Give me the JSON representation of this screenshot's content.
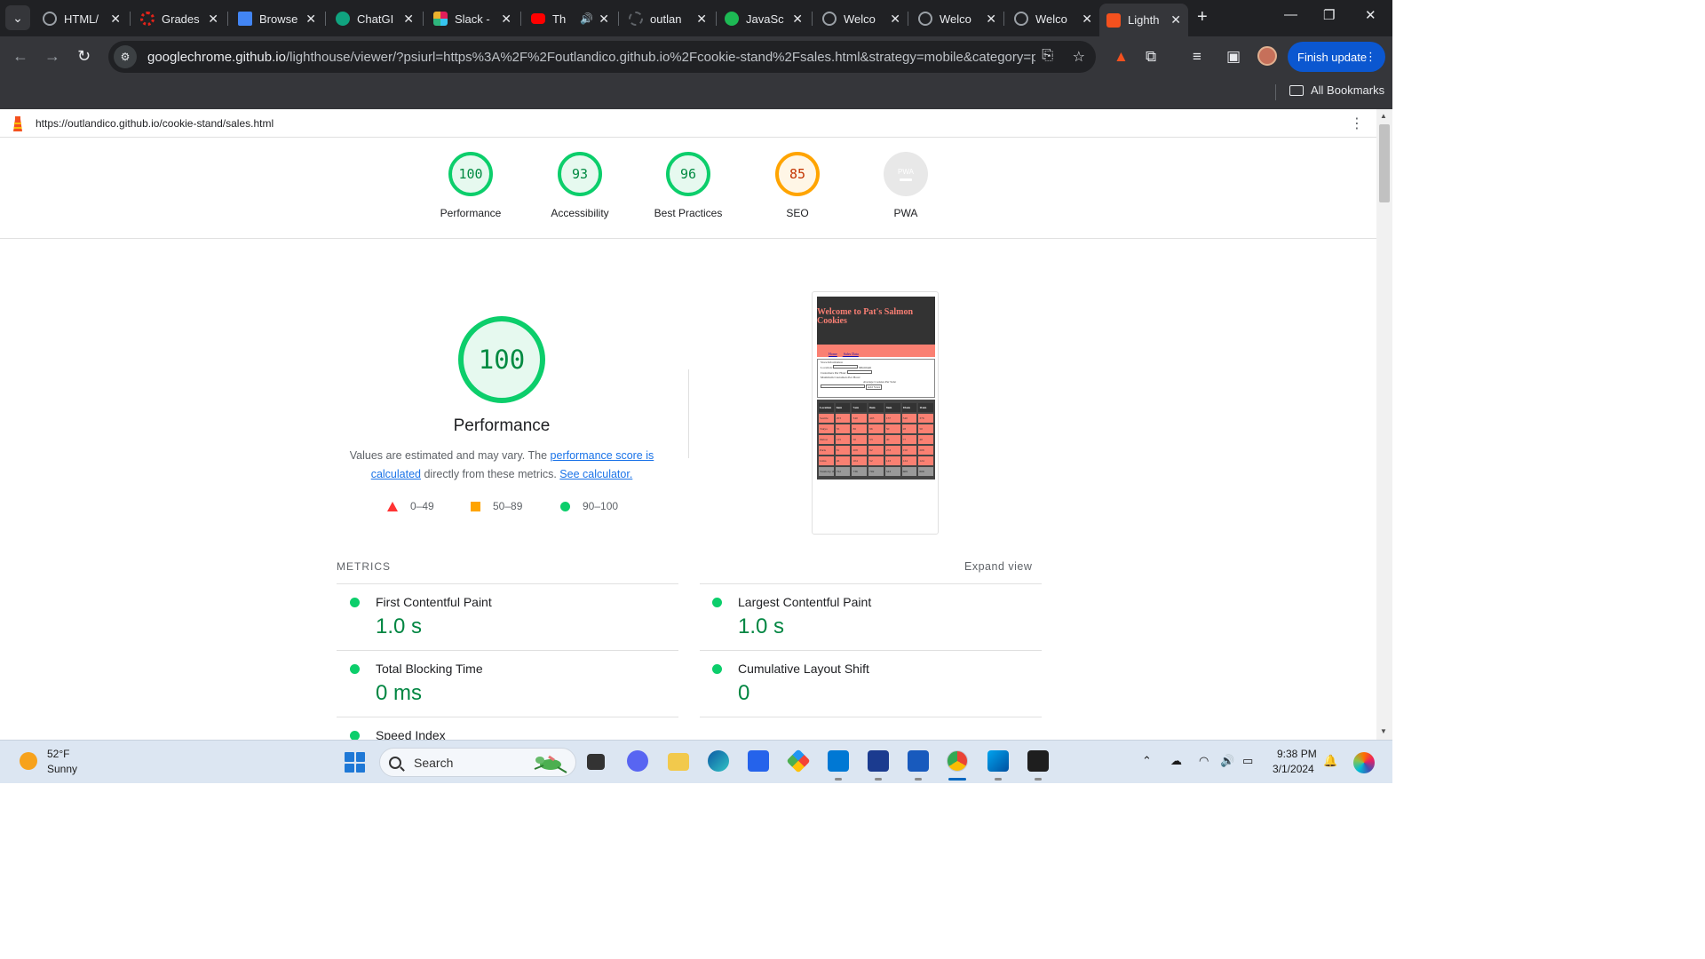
{
  "browser": {
    "tabs": [
      {
        "title": "HTML/",
        "color": "#9aa0a6"
      },
      {
        "title": "Grades",
        "color": "#e2231a"
      },
      {
        "title": "Browse",
        "color": "#4285f4"
      },
      {
        "title": "ChatGI",
        "color": "#10a37f"
      },
      {
        "title": "Slack -",
        "color": "#e01e5a"
      },
      {
        "title": "Th",
        "color": "#ff0000"
      },
      {
        "title": "outlan",
        "color": "#202124"
      },
      {
        "title": "JavaSc",
        "color": "#1db954"
      },
      {
        "title": "Welco",
        "color": "#9aa0a6"
      },
      {
        "title": "Welco",
        "color": "#9aa0a6"
      },
      {
        "title": "Welco",
        "color": "#9aa0a6"
      },
      {
        "title": "Lighth",
        "color": "#f4511e"
      }
    ],
    "url_host": "googlechrome.github.io",
    "url_rest": "/lighthouse/viewer/?psiurl=https%3A%2F%2Foutlandico.github.io%2Fcookie-stand%2Fsales.html&strategy=mobile&category=perfo...",
    "finish_update": "Finish update",
    "all_bookmarks": "All Bookmarks"
  },
  "report": {
    "page_url": "https://outlandico.github.io/cookie-stand/sales.html",
    "scores": [
      {
        "label": "Performance",
        "score": "100",
        "status": "pass"
      },
      {
        "label": "Accessibility",
        "score": "93",
        "status": "pass"
      },
      {
        "label": "Best Practices",
        "score": "96",
        "status": "pass"
      },
      {
        "label": "SEO",
        "score": "85",
        "status": "average"
      },
      {
        "label": "PWA",
        "score": "PWA",
        "status": "na"
      }
    ],
    "performance": {
      "score": "100",
      "title": "Performance",
      "desc_prefix": "Values are estimated and may vary. The ",
      "desc_link1": "performance score is calculated",
      "desc_middle": " directly from these metrics. ",
      "desc_link2": "See calculator.",
      "legend": {
        "fail": "0–49",
        "average": "50–89",
        "pass": "90–100"
      }
    },
    "thumbnail": {
      "heading": "Welcome to Pat's Salmon Cookies",
      "nav": [
        "Home",
        "Sales Data"
      ],
      "form_lines": [
        "Store Information",
        "Location:",
        "Minimum",
        "Customers Per Hour:",
        "Maximum Customers Per Hour:",
        "Average Cookies Per Sale:",
        "Add Store"
      ],
      "table_header": [
        "Location",
        "6am",
        "7am",
        "8am",
        "9am",
        "10am",
        "11am"
      ],
      "table_rows": [
        [
          "Seattle",
          "203",
          "340",
          "403",
          "157",
          "340",
          "376"
        ],
        [
          "Tokyo",
          "55",
          "86",
          "96",
          "50",
          "28",
          "50"
        ],
        [
          "Dubai",
          "125",
          "50",
          "53",
          "40",
          "77",
          "40"
        ],
        [
          "Paris",
          "81",
          "208",
          "92",
          "253",
          "150",
          "208"
        ],
        [
          "Lima",
          "46",
          "104",
          "52",
          "143",
          "124",
          "124"
        ]
      ],
      "totals_row": [
        "Totals by the hour",
        "722",
        "736",
        "702",
        "543",
        "609",
        "808"
      ]
    },
    "metrics": {
      "heading": "METRICS",
      "expand": "Expand view",
      "items": [
        {
          "name": "First Contentful Paint",
          "value": "1.0 s"
        },
        {
          "name": "Largest Contentful Paint",
          "value": "1.0 s"
        },
        {
          "name": "Total Blocking Time",
          "value": "0 ms"
        },
        {
          "name": "Cumulative Layout Shift",
          "value": "0"
        },
        {
          "name": "Speed Index",
          "value": ""
        }
      ]
    }
  },
  "taskbar": {
    "temp": "52°F",
    "condition": "Sunny",
    "search": "Search",
    "time": "9:38 PM",
    "date": "3/1/2024"
  },
  "colors": {
    "pass": "#0cce6b",
    "average": "#ffa400",
    "fail": "#ff3333",
    "chrome_dark": "#202124",
    "finish_blue": "#0b57d0"
  }
}
